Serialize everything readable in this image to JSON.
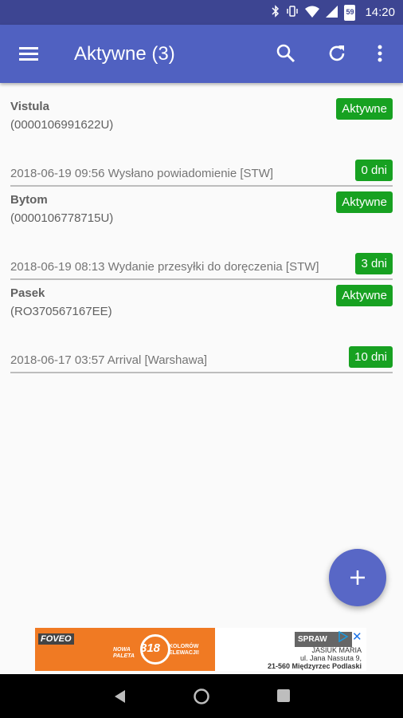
{
  "status_bar": {
    "time": "14:20",
    "battery": "59",
    "icons": [
      "bluetooth-icon",
      "vibrate-icon",
      "wifi-icon",
      "signal-icon",
      "battery-icon"
    ]
  },
  "app_bar": {
    "title": "Aktywne (3)",
    "actions": [
      "menu-icon",
      "search-icon",
      "refresh-icon",
      "more-vert-icon"
    ]
  },
  "shipments": [
    {
      "name": "Vistula",
      "tracking": "(0000106991622U)",
      "status": "Aktywne",
      "last_event": "2018-06-19 09:56 Wysłano powiadomienie [STW]",
      "days": "0 dni"
    },
    {
      "name": "Bytom",
      "tracking": "(0000106778715U)",
      "status": "Aktywne",
      "last_event": "2018-06-19 08:13 Wydanie przesyłki do doręczenia [STW]",
      "days": "3 dni"
    },
    {
      "name": "Pasek",
      "tracking": "(RO370567167EE)",
      "status": "Aktywne",
      "last_event": "2018-06-17 03:57 Arrival [Warshawa]",
      "days": "10 dni"
    }
  ],
  "ad": {
    "brand": "FOVEO",
    "line1": "NOWA",
    "line2": "PALETA",
    "number": "318",
    "colors1": "KOLORÓW",
    "colors2": "ELEWACJI!",
    "cta": "SPRAW",
    "advertiser": "JASIUK MARIA",
    "street": "ul. Jana Nassuta 9,",
    "city": "21-560 Międzyrzec Podlaski",
    "close": "✕"
  },
  "colors": {
    "status_bar": "#3d4592",
    "app_bar": "#5061c1",
    "badge_green": "#17a121",
    "fab": "#5867c6"
  }
}
